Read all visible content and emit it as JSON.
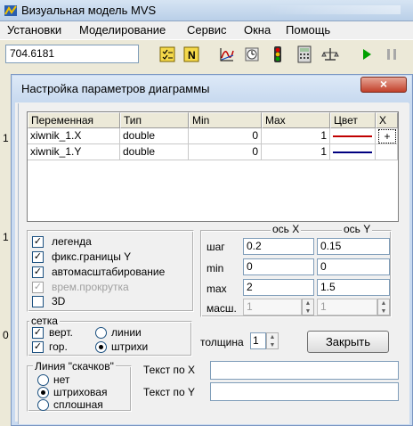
{
  "app": {
    "title": "Визуальная модель MVS",
    "menu": [
      "Установки",
      "Моделирование",
      "Сервис",
      "Окна",
      "Помощь"
    ],
    "value_field": "704.6181",
    "toolbar_icons": [
      "checklist-icon",
      "n-icon",
      "chart-icon",
      "clock-icon",
      "traffic-light-icon",
      "calculator-icon",
      "scale-icon",
      "play-icon",
      "pause-icon"
    ],
    "side_numbers": [
      "1",
      "1",
      "0"
    ]
  },
  "dialog": {
    "title": "Настройка параметров диаграммы",
    "close_glyph": "×",
    "table": {
      "headers": [
        "Переменная",
        "Тип",
        "Min",
        "Max",
        "Цвет",
        "X"
      ],
      "rows": [
        {
          "name": "xiwnik_1.X",
          "type": "double",
          "min": "0",
          "max": "1",
          "color": "#c00000",
          "x": "+"
        },
        {
          "name": "xiwnik_1.Y",
          "type": "double",
          "min": "0",
          "max": "1",
          "color": "#000080",
          "x": ""
        }
      ]
    },
    "options": {
      "legend": {
        "label": "легенда",
        "checked": true
      },
      "fixed_y": {
        "label": "фикс.границы Y",
        "checked": true
      },
      "autoscale": {
        "label": "автомасштабирование",
        "checked": true
      },
      "scroll_time": {
        "label": "врем.прокрутка",
        "checked": true,
        "disabled": true
      },
      "three_d": {
        "label": "3D",
        "checked": false
      }
    },
    "axes": {
      "col_x": "ось X",
      "col_y": "ось Y",
      "rows": [
        {
          "label": "шаг",
          "x": "0.2",
          "y": "0.15"
        },
        {
          "label": "min",
          "x": "0",
          "y": "0"
        },
        {
          "label": "max",
          "x": "2",
          "y": "1.5"
        },
        {
          "label": "масш.",
          "x": "1",
          "y": "1"
        }
      ]
    },
    "grid": {
      "title": "сетка",
      "vert": {
        "label": "верт.",
        "checked": true
      },
      "hor": {
        "label": "гор.",
        "checked": true
      },
      "lines": {
        "label": "линии",
        "selected": false
      },
      "dashes": {
        "label": "штрихи",
        "selected": true
      }
    },
    "thickness": {
      "label": "толщина",
      "value": "1"
    },
    "close_button": "Закрыть",
    "jumps": {
      "title": "Линия \"скачков\"",
      "none": {
        "label": "нет",
        "selected": false
      },
      "dashed": {
        "label": "штриховая",
        "selected": true
      },
      "solid": {
        "label": "сплошная",
        "selected": false
      }
    },
    "text_x": {
      "label": "Текст по X",
      "value": ""
    },
    "text_y": {
      "label": "Текст по Y",
      "value": ""
    }
  }
}
